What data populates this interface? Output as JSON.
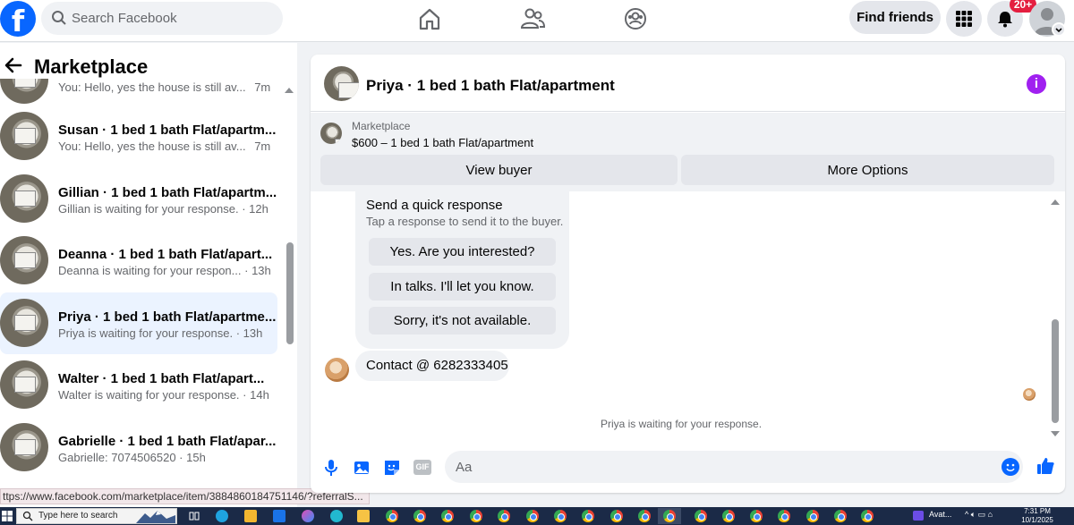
{
  "topbar": {
    "logo": "f",
    "search_placeholder": "Search Facebook",
    "nav_icons": [
      "home-icon",
      "friends-icon",
      "groups-icon"
    ],
    "find_friends": "Find friends",
    "notification_badge": "20+"
  },
  "sidebar": {
    "title": "Marketplace",
    "conversations": [
      {
        "name": "",
        "preview": "You: Hello, yes the house is still av...",
        "time": "7m"
      },
      {
        "name": "Susan · 1 bed 1 bath Flat/apartm...",
        "preview": "You: Hello, yes the house is still av...",
        "time": "7m"
      },
      {
        "name": "Gillian · 1 bed 1 bath Flat/apartm...",
        "preview": "Gillian is waiting for your response.",
        "time": "12h"
      },
      {
        "name": "Deanna · 1 bed 1 bath Flat/apart...",
        "preview": "Deanna is waiting for your respon...",
        "time": "13h"
      },
      {
        "name": "Priya · 1 bed 1 bath Flat/apartme...",
        "preview": "Priya is waiting for your response.",
        "time": "13h"
      },
      {
        "name": "Walter · 1 bed 1 bath Flat/apart...",
        "preview": "Walter is waiting for your response.",
        "time": "14h"
      },
      {
        "name": "Gabrielle · 1 bed 1 bath Flat/apar...",
        "preview": "Gabrielle: 7074506520",
        "time": "15h"
      }
    ]
  },
  "status_url": "ttps://www.facebook.com/marketplace/item/3884860184751146/?referralS...",
  "chat": {
    "title": "Priya · 1 bed 1 bath Flat/apartment",
    "listing_label": "Marketplace",
    "listing_price": "$600 – 1 bed 1 bath Flat/apartment",
    "view_buyer": "View buyer",
    "more_options": "More Options",
    "quick_response_title": "Send a quick response",
    "quick_response_sub": "Tap a response to send it to the buyer.",
    "quick_responses": [
      "Yes. Are you interested?",
      "In talks. I'll let you know.",
      "Sorry, it's not available."
    ],
    "contact_message": "Contact @ 6282333405",
    "waiting_text": "Priya is waiting for your response.",
    "input_placeholder": "Aa"
  },
  "taskbar": {
    "search_placeholder": "Type here to search",
    "tray_app": "Avat...",
    "time": "7:31 PM",
    "date": "10/1/2025"
  }
}
